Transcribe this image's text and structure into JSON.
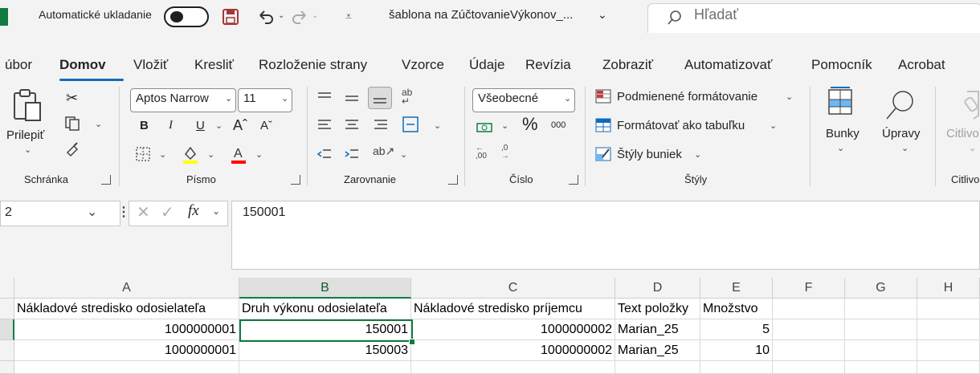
{
  "titlebar": {
    "autosave_label": "Automatické ukladanie",
    "filename": "šablona na ZúčtovanieVýkonov_...",
    "search_placeholder": "Hľadať"
  },
  "menu": {
    "items": [
      "úbor",
      "Domov",
      "Vložiť",
      "Kresliť",
      "Rozloženie strany",
      "Vzorce",
      "Údaje",
      "Revízia",
      "Zobraziť",
      "Automatizovať",
      "Pomocník",
      "Acrobat"
    ],
    "active": "Domov"
  },
  "ribbon": {
    "clipboard": {
      "paste_label": "Prilepiť",
      "group_label": "Schránka"
    },
    "font": {
      "font_name": "Aptos Narrow",
      "font_size": "11",
      "group_label": "Písmo",
      "highlight_color": "#ffff00",
      "font_color": "#ff0000"
    },
    "alignment": {
      "group_label": "Zarovnanie"
    },
    "number": {
      "format": "Všeobecné",
      "group_label": "Číslo",
      "percent": "%",
      "thousands": "000",
      "dec_increase": ",00",
      "dec_decrease": ",0"
    },
    "styles": {
      "conditional": "Podmienené formátovanie",
      "as_table": "Formátovať ako tabuľku",
      "cell_styles": "Štýly buniek",
      "group_label": "Štýly"
    },
    "cells": {
      "label": "Bunky"
    },
    "editing": {
      "label": "Úpravy"
    },
    "sensitivity": {
      "label": "Citlivo",
      "group_label": "Citlivo"
    }
  },
  "formula_bar": {
    "name_box": "2",
    "fx": "fx",
    "value": "150001"
  },
  "grid": {
    "columns": [
      "A",
      "B",
      "C",
      "D",
      "E",
      "F",
      "G",
      "H"
    ],
    "selected_column": "B",
    "rows": [
      [
        "Nákladové stredisko odosielateľa",
        "Druh výkonu odosielateľa",
        "Nákladové stredisko príjemcu",
        "Text položky",
        "Množstvo",
        "",
        "",
        ""
      ],
      [
        "1000000001",
        "150001",
        "1000000002",
        "Marian_25",
        "5",
        "",
        "",
        ""
      ],
      [
        "1000000001",
        "150003",
        "1000000002",
        "Marian_25",
        "10",
        "",
        "",
        ""
      ]
    ]
  },
  "colors": {
    "accent": "#107c41",
    "tab_underline": "#0f6cbd",
    "chrome": "#f3f3f3"
  }
}
